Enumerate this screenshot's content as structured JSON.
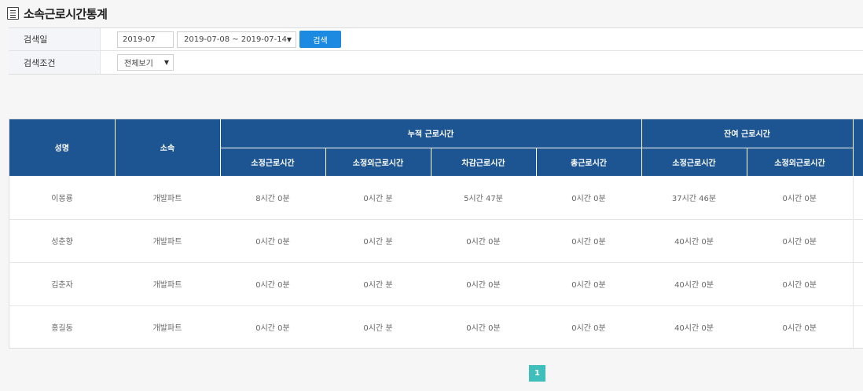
{
  "header": {
    "title": "소속근로시간통계",
    "icon": "list-document-icon"
  },
  "search": {
    "date_label": "검색일",
    "month_value": "2019-07",
    "week_range_value": "2019-07-08 ~ 2019-07-14",
    "search_button": "검색",
    "condition_label": "검색조건",
    "condition_value": "전체보기"
  },
  "table": {
    "headers": {
      "name": "성명",
      "department": "소속",
      "cumulative_group": "누적 근로시간",
      "remaining_group": "잔여 근로시간",
      "cum_regular": "소정근로시간",
      "cum_overtime": "소정외근로시간",
      "cum_deduction": "차감근로시간",
      "cum_total": "총근로시간",
      "rem_regular": "소정근로시간",
      "rem_overtime": "소정외근로시간"
    },
    "rows": [
      {
        "name": "이몽룡",
        "department": "개발파트",
        "cum_regular": "8시간 0분",
        "cum_overtime": "0시간 분",
        "cum_deduction": "5시간 47분",
        "cum_total": "0시간 0분",
        "rem_regular": "37시간 46분",
        "rem_overtime": "0시간 0분"
      },
      {
        "name": "성춘향",
        "department": "개발파트",
        "cum_regular": "0시간 0분",
        "cum_overtime": "0시간 분",
        "cum_deduction": "0시간 0분",
        "cum_total": "0시간 0분",
        "rem_regular": "40시간 0분",
        "rem_overtime": "0시간 0분"
      },
      {
        "name": "김춘자",
        "department": "개발파트",
        "cum_regular": "0시간 0분",
        "cum_overtime": "0시간 분",
        "cum_deduction": "0시간 0분",
        "cum_total": "0시간 0분",
        "rem_regular": "40시간 0분",
        "rem_overtime": "0시간 0분"
      },
      {
        "name": "홍길동",
        "department": "개발파트",
        "cum_regular": "0시간 0분",
        "cum_overtime": "0시간 분",
        "cum_deduction": "0시간 0분",
        "cum_total": "0시간 0분",
        "rem_regular": "40시간 0분",
        "rem_overtime": "0시간 0분"
      }
    ]
  },
  "pagination": {
    "current": "1"
  },
  "colors": {
    "header_bg": "#1d5593",
    "search_button": "#1c8ae0",
    "page_active": "#3fbfbc"
  }
}
